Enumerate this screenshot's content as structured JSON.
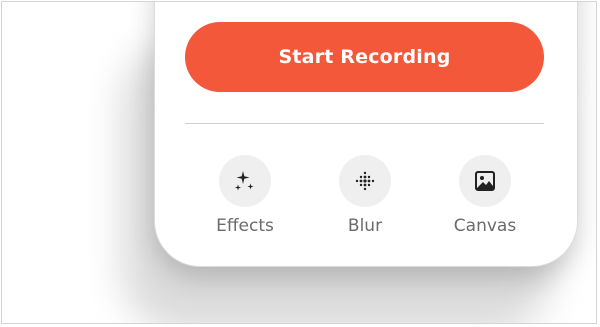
{
  "colors": {
    "accent": "#f4583a",
    "icon_bg": "#efefef",
    "label": "#6b6b6b"
  },
  "record_button": {
    "label": "Start Recording"
  },
  "tools": [
    {
      "label": "Effects",
      "icon": "sparkles-icon"
    },
    {
      "label": "Blur",
      "icon": "dot-grid-icon"
    },
    {
      "label": "Canvas",
      "icon": "image-icon"
    }
  ]
}
